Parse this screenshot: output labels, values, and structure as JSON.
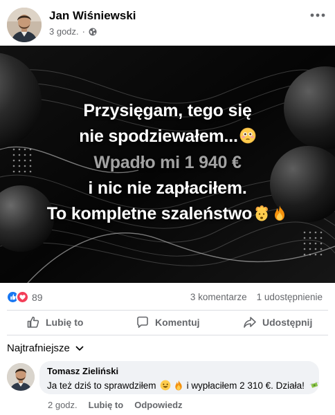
{
  "post": {
    "author": "Jan Wiśniewski",
    "time": "3 godz.",
    "separator": "·",
    "audience_icon": "globe-icon",
    "more_icon": "more-horizontal-icon"
  },
  "image": {
    "line1": "Przysięgam, tego się",
    "line2": "nie spodziewałem...",
    "line3": "Wpadło mi 1 940 €",
    "line4": "i nic nie zapłaciłem.",
    "line5": "To kompletne szaleństwo",
    "emoji_line2": "flushed-face-emoji",
    "emoji_line5": [
      "exploding-head-emoji",
      "fire-emoji"
    ],
    "highlight_color": "#a2a2a2"
  },
  "stats": {
    "reactions": [
      "like",
      "love"
    ],
    "reaction_count": "89",
    "comments": "3 komentarze",
    "shares": "1 udostępnienie"
  },
  "actions": {
    "like": "Lubię to",
    "comment": "Komentuj",
    "share": "Udostępnij"
  },
  "comments": {
    "sort_label": "Najtrafniejsze",
    "items": [
      {
        "author": "Tomasz Zieliński",
        "text_before": "Ja też dziś to sprawdziłem",
        "emojis": [
          "smiling-face-emoji",
          "fire-emoji"
        ],
        "text_after": "i wypłaciłem 2 310 €. Działa!",
        "end_emoji": "money-with-wings-emoji",
        "time": "2 godz.",
        "like_label": "Lubię to",
        "reply_label": "Odpowiedz"
      }
    ]
  },
  "colors": {
    "primary_text": "#050505",
    "secondary_text": "#65676b",
    "like_blue": "#1877f2",
    "love_red": "#f33e58",
    "bubble_bg": "#f0f2f5",
    "divider": "#dadde1"
  }
}
